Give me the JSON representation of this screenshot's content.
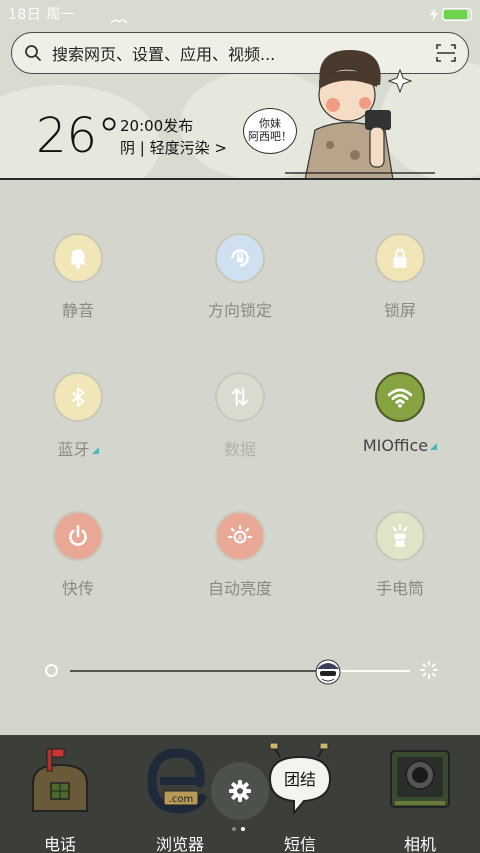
{
  "status_bar": {
    "date": "18日 周一",
    "battery_level": 0.9
  },
  "search": {
    "placeholder": "搜索网页、设置、应用、视频..."
  },
  "weather": {
    "temperature": "26°",
    "publish_time": "20:00发布",
    "condition": "阴 | 轻度污染 >"
  },
  "speech_bubble": {
    "line1": "你妹",
    "line2": "阿西吧！"
  },
  "toggles": [
    {
      "label": "静音",
      "icon": "bell-icon",
      "color": "#f0e6b8",
      "active": false
    },
    {
      "label": "方向锁定",
      "icon": "rotation-lock-icon",
      "color": "#cfe0f0",
      "active": false
    },
    {
      "label": "锁屏",
      "icon": "lock-icon",
      "color": "#f0e6b8",
      "active": false
    },
    {
      "label": "蓝牙",
      "icon": "bluetooth-icon",
      "color": "#f0e6b8",
      "active": false
    },
    {
      "label": "数据",
      "icon": "data-arrows-icon",
      "color": "#d7dccf",
      "active": false
    },
    {
      "label": "MIOffice",
      "icon": "wifi-icon",
      "color": "#86a341",
      "active": true
    },
    {
      "label": "快传",
      "icon": "power-share-icon",
      "color": "#e9a896",
      "active": false
    },
    {
      "label": "自动亮度",
      "icon": "auto-brightness-icon",
      "color": "#e9a896",
      "active": false
    },
    {
      "label": "手电筒",
      "icon": "flashlight-icon",
      "color": "#dfe3c8",
      "active": false
    }
  ],
  "brightness": {
    "level": 0.76
  },
  "dock": [
    {
      "label": "电话",
      "icon": "mailbox-icon"
    },
    {
      "label": "浏览器",
      "icon": "browser-icon"
    },
    {
      "label": "短信",
      "icon": "message-bubble-icon",
      "bubble_text": "团结"
    },
    {
      "label": "相机",
      "icon": "camera-icon"
    }
  ],
  "browser_tag": ".com"
}
